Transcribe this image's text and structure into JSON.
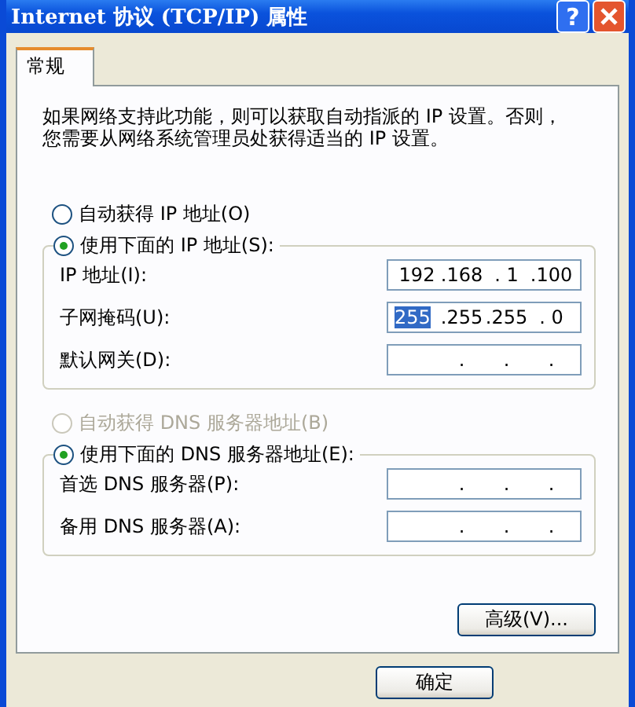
{
  "window": {
    "title": "Internet 协议 (TCP/IP) 属性",
    "help_button": "?"
  },
  "tabs": [
    {
      "label": "常规",
      "selected": true
    }
  ],
  "description": "如果网络支持此功能，则可以获取自动指派的 IP 设置。否则，您需要从网络系统管理员处获得适当的 IP 设置。",
  "sections": [
    {
      "auto": {
        "label": "自动获得 IP 地址(O)",
        "checked": false,
        "disabled": false
      },
      "manual": {
        "label": "使用下面的 IP 地址(S):",
        "checked": true,
        "disabled": false
      },
      "fields": [
        {
          "label": "IP 地址(I):",
          "cells": [
            {
              "text": "192",
              "selected": false
            },
            {
              "text": ".168",
              "selected": false
            },
            {
              "text": ". 1",
              "selected": false
            },
            {
              "text": ".100",
              "selected": false
            }
          ]
        },
        {
          "label": "子网掩码(U):",
          "cells": [
            {
              "text": "255",
              "selected": true
            },
            {
              "text": ".255",
              "selected": false
            },
            {
              "text": ".255",
              "selected": false
            },
            {
              "text": ". 0",
              "selected": false
            }
          ]
        },
        {
          "label": "默认网关(D):",
          "cells": [
            {
              "text": ".",
              "selected": false
            },
            {
              "text": ".",
              "selected": false
            },
            {
              "text": ".",
              "selected": false
            }
          ]
        }
      ]
    },
    {
      "auto": {
        "label": "自动获得 DNS 服务器地址(B)",
        "checked": false,
        "disabled": true
      },
      "manual": {
        "label": "使用下面的 DNS 服务器地址(E):",
        "checked": true,
        "disabled": false
      },
      "fields": [
        {
          "label": "首选 DNS 服务器(P):",
          "cells": [
            {
              "text": ".",
              "selected": false
            },
            {
              "text": ".",
              "selected": false
            },
            {
              "text": ".",
              "selected": false
            }
          ]
        },
        {
          "label": "备用 DNS 服务器(A):",
          "cells": [
            {
              "text": ".",
              "selected": false
            },
            {
              "text": ".",
              "selected": false
            },
            {
              "text": ".",
              "selected": false
            }
          ]
        }
      ]
    }
  ],
  "advanced_button": "高级(V)...",
  "buttons": [
    "确定"
  ]
}
